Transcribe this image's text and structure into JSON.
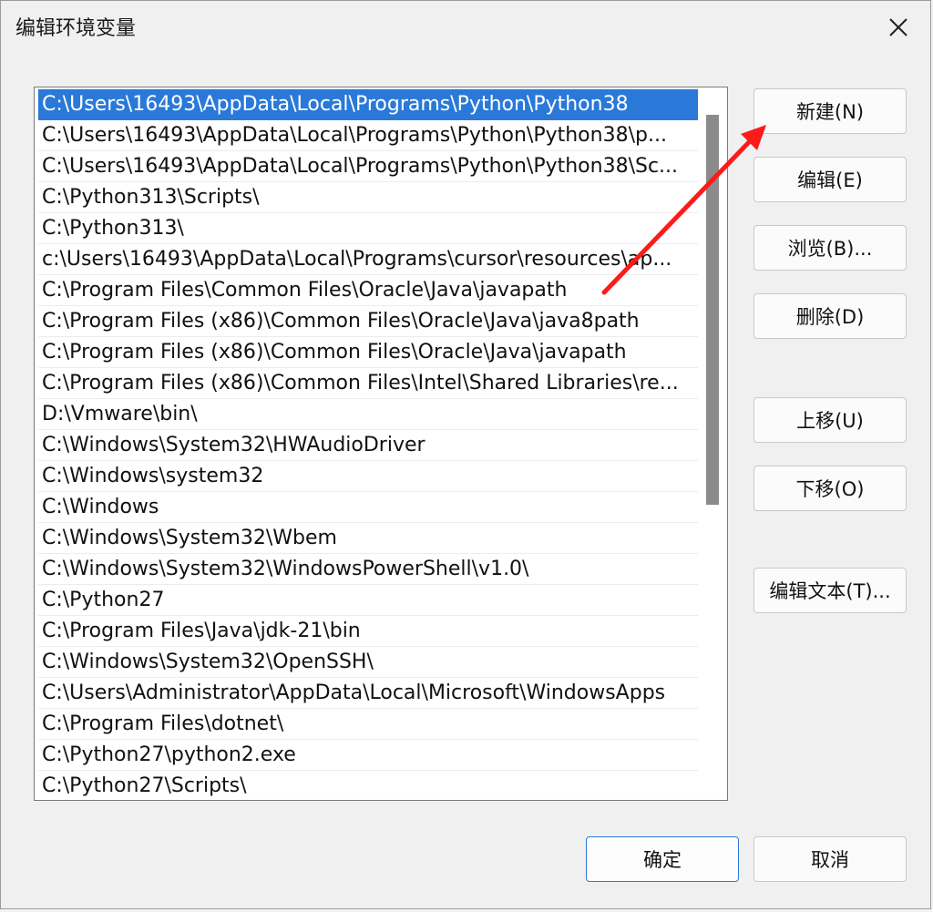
{
  "dialog": {
    "title": "编辑环境变量"
  },
  "list": {
    "selected_index": 0,
    "items": [
      "C:\\Users\\16493\\AppData\\Local\\Programs\\Python\\Python38",
      "C:\\Users\\16493\\AppData\\Local\\Programs\\Python\\Python38\\p...",
      "C:\\Users\\16493\\AppData\\Local\\Programs\\Python\\Python38\\Sc...",
      "C:\\Python313\\Scripts\\",
      "C:\\Python313\\",
      "c:\\Users\\16493\\AppData\\Local\\Programs\\cursor\\resources\\ap...",
      "C:\\Program Files\\Common Files\\Oracle\\Java\\javapath",
      "C:\\Program Files (x86)\\Common Files\\Oracle\\Java\\java8path",
      "C:\\Program Files (x86)\\Common Files\\Oracle\\Java\\javapath",
      "C:\\Program Files (x86)\\Common Files\\Intel\\Shared Libraries\\re...",
      "D:\\Vmware\\bin\\",
      "C:\\Windows\\System32\\HWAudioDriver",
      "C:\\Windows\\system32",
      "C:\\Windows",
      "C:\\Windows\\System32\\Wbem",
      "C:\\Windows\\System32\\WindowsPowerShell\\v1.0\\",
      "C:\\Python27",
      "C:\\Program Files\\Java\\jdk-21\\bin",
      "C:\\Windows\\System32\\OpenSSH\\",
      "C:\\Users\\Administrator\\AppData\\Local\\Microsoft\\WindowsApps",
      "C:\\Program Files\\dotnet\\",
      "C:\\Python27\\python2.exe",
      "C:\\Python27\\Scripts\\"
    ]
  },
  "buttons": {
    "new": "新建(N)",
    "edit": "编辑(E)",
    "browse": "浏览(B)...",
    "delete": "删除(D)",
    "move_up": "上移(U)",
    "move_down": "下移(O)",
    "edit_text": "编辑文本(T)...",
    "ok": "确定",
    "cancel": "取消"
  },
  "icons": {
    "close": "close-icon"
  },
  "colors": {
    "selection": "#2a79d8",
    "annotation_arrow": "#ff1a1a"
  }
}
